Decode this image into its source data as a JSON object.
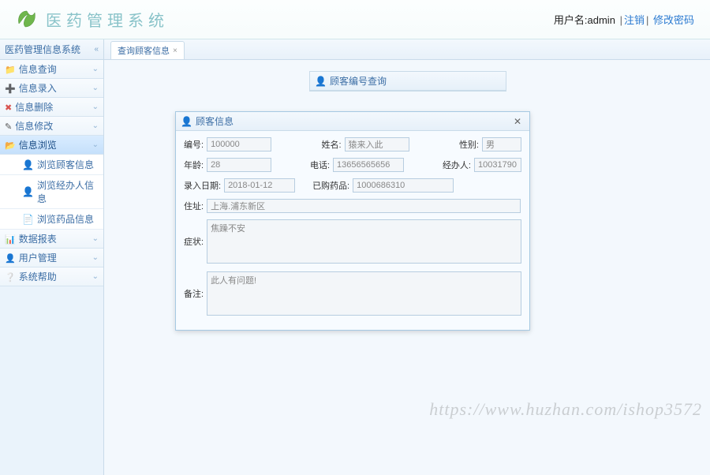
{
  "app_title": "医药管理系统",
  "user": {
    "label": "用户名:",
    "name": "admin",
    "logout": "注销",
    "changepw": "修改密码"
  },
  "sidebar": {
    "root": "医药管理信息系统",
    "items": [
      {
        "label": "信息查询",
        "icon": "📁",
        "icoClass": "ico-orange"
      },
      {
        "label": "信息录入",
        "icon": "➕",
        "icoClass": "ico-green"
      },
      {
        "label": "信息删除",
        "icon": "✖",
        "icoClass": "ico-red"
      },
      {
        "label": "信息修改",
        "icon": "✎",
        "icoClass": "ico-dark"
      },
      {
        "label": "信息浏览",
        "icon": "📂",
        "icoClass": "ico-orange",
        "active": true
      },
      {
        "label": "数据报表",
        "icon": "📊",
        "icoClass": "ico-blue2"
      },
      {
        "label": "用户管理",
        "icon": "👤",
        "icoClass": "ico-blue2"
      },
      {
        "label": "系统帮助",
        "icon": "❔",
        "icoClass": "ico-blue2"
      }
    ],
    "subitems": [
      {
        "label": "浏览顾客信息",
        "icon": "👤"
      },
      {
        "label": "浏览经办人信息",
        "icon": "👤"
      },
      {
        "label": "浏览药品信息",
        "icon": "📄"
      }
    ]
  },
  "tab": {
    "label": "查询顾客信息",
    "close": "×"
  },
  "small_panel_title": "顾客编号查询",
  "dialog": {
    "title": "顾客信息",
    "labels": {
      "id": "编号:",
      "name": "姓名:",
      "gender": "性别:",
      "age": "年龄:",
      "phone": "电话:",
      "agent": "经办人:",
      "date": "录入日期:",
      "drug": "已购药品:",
      "addr": "住址:",
      "symptom": "症状:",
      "remark": "备注:"
    },
    "values": {
      "id": "100000",
      "name": "猿来入此",
      "gender": "男",
      "age": "28",
      "phone": "13656565656",
      "agent": "10031790",
      "date": "2018-01-12",
      "drug": "1000686310",
      "addr": "上海.浦东新区",
      "symptom": "焦躁不安",
      "remark": "此人有问题!"
    }
  },
  "watermark": "https://www.huzhan.com/ishop3572"
}
